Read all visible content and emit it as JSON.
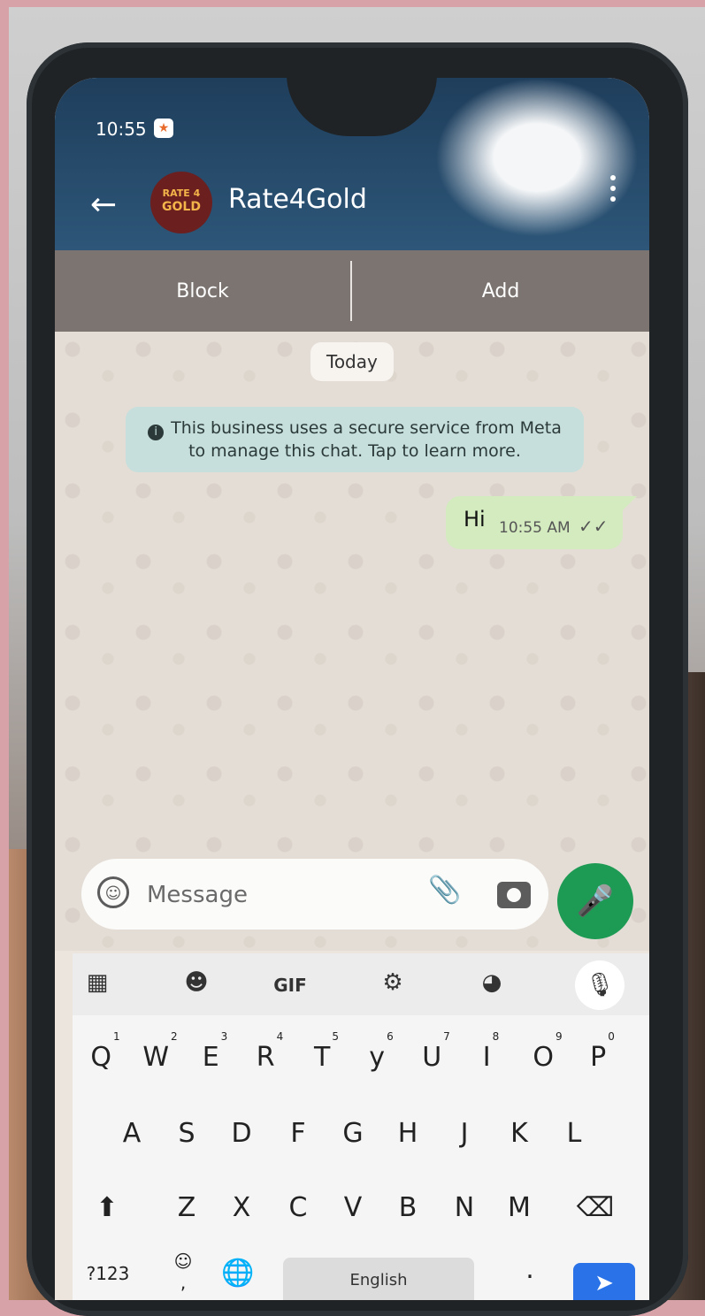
{
  "status_bar": {
    "time": "10:55"
  },
  "header": {
    "contact_name": "Rate4Gold",
    "avatar_line1": "RATE 4",
    "avatar_line2": "GOLD"
  },
  "action_bar": {
    "block_label": "Block",
    "add_label": "Add"
  },
  "chat": {
    "date_chip": "Today",
    "security_notice": "This business uses a secure service from Meta to manage this chat. Tap to learn more.",
    "messages": [
      {
        "text": "Hi",
        "time": "10:55 AM",
        "status": "read"
      }
    ]
  },
  "composer": {
    "placeholder": "Message"
  },
  "keyboard": {
    "gif_label": "GIF",
    "row1": [
      "Q",
      "W",
      "E",
      "R",
      "T",
      "y",
      "U",
      "I",
      "O",
      "P"
    ],
    "row1_hints": [
      "1",
      "2",
      "3",
      "4",
      "5",
      "6",
      "7",
      "8",
      "9",
      "0"
    ],
    "row2": [
      "A",
      "S",
      "D",
      "F",
      "G",
      "H",
      "J",
      "K",
      "L"
    ],
    "row3": [
      "Z",
      "X",
      "C",
      "V",
      "B",
      "N",
      "M"
    ],
    "symbols_label": "?123",
    "comma_label": ",",
    "space_label": "English",
    "period_label": "."
  },
  "colors": {
    "header": "#1f3e5c",
    "send_button": "#1d9b54",
    "outgoing_bubble": "#d3ebbf",
    "notice": "#c6dfdc"
  }
}
